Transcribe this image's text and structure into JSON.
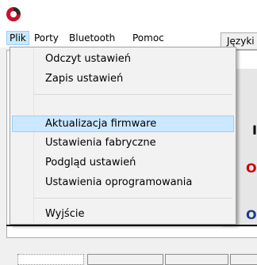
{
  "menubar": {
    "items": [
      {
        "label": "Plik",
        "open": true
      },
      {
        "label": "Porty"
      },
      {
        "label": "Bluetooth"
      },
      {
        "label": "Pomoc"
      }
    ]
  },
  "background": {
    "tab_label": "Języki",
    "letters": [
      "I",
      "O",
      "O"
    ],
    "accent_red": "#cc0000",
    "accent_blue": "#1a3c8c"
  },
  "file_menu": {
    "items": [
      {
        "label": "Odczyt ustawień"
      },
      {
        "label": "Zapis ustawień"
      },
      {
        "label": "Aktualizacja firmware",
        "highlighted": true
      },
      {
        "label": "Ustawienia fabryczne"
      },
      {
        "label": "Podgląd ustawień"
      },
      {
        "label": "Ustawienia oprogramowania"
      },
      {
        "label": "Wyjście"
      }
    ]
  },
  "icons": {
    "app": "app-logo-icon"
  }
}
